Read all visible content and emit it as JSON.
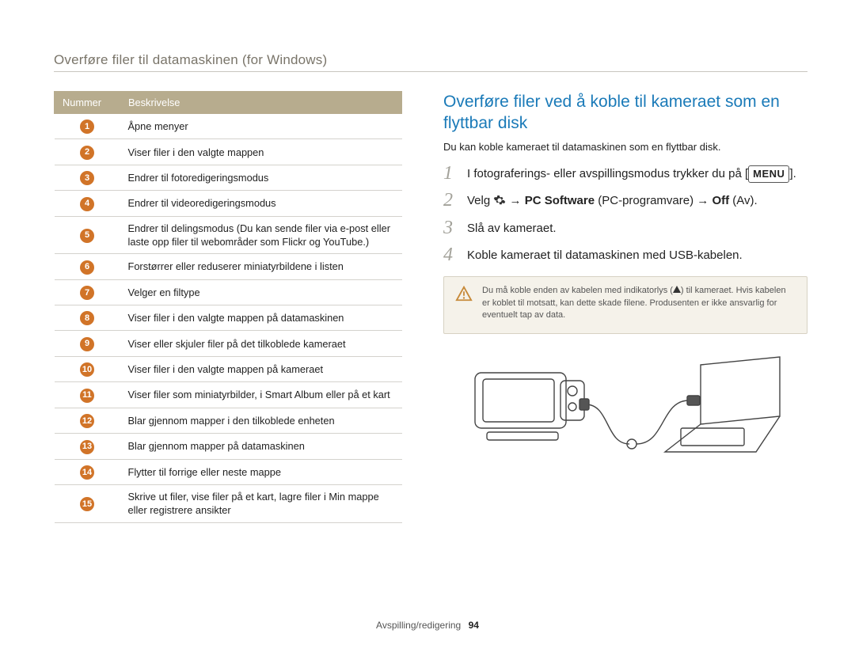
{
  "header": {
    "section_title": "Overføre filer til datamaskinen (for Windows)"
  },
  "table": {
    "columns": {
      "num": "Nummer",
      "desc": "Beskrivelse"
    },
    "rows": [
      {
        "n": "1",
        "desc": "Åpne menyer"
      },
      {
        "n": "2",
        "desc": "Viser filer i den valgte mappen"
      },
      {
        "n": "3",
        "desc": "Endrer til fotoredigeringsmodus"
      },
      {
        "n": "4",
        "desc": "Endrer til videoredigeringsmodus"
      },
      {
        "n": "5",
        "desc": "Endrer til delingsmodus (Du kan sende filer via e-post eller laste opp filer til webområder som Flickr og YouTube.)"
      },
      {
        "n": "6",
        "desc": "Forstørrer eller reduserer miniatyrbildene i listen"
      },
      {
        "n": "7",
        "desc": "Velger en filtype"
      },
      {
        "n": "8",
        "desc": "Viser filer i den valgte mappen på datamaskinen"
      },
      {
        "n": "9",
        "desc": "Viser eller skjuler filer på det tilkoblede kameraet"
      },
      {
        "n": "10",
        "desc": "Viser filer i den valgte mappen på kameraet"
      },
      {
        "n": "11",
        "desc": "Viser filer som miniatyrbilder, i Smart Album eller på et kart"
      },
      {
        "n": "12",
        "desc": "Blar gjennom mapper i den tilkoblede enheten"
      },
      {
        "n": "13",
        "desc": "Blar gjennom mapper på datamaskinen"
      },
      {
        "n": "14",
        "desc": "Flytter til forrige eller neste mappe"
      },
      {
        "n": "15",
        "desc": "Skrive ut filer, vise filer på et kart, lagre filer i Min mappe eller registrere ansikter"
      }
    ]
  },
  "right": {
    "heading": "Overføre filer ved å koble til kameraet som en flyttbar disk",
    "intro": "Du kan koble kameraet til datamaskinen som en flyttbar disk.",
    "steps": {
      "s1_a": "I fotograferings- eller avspillingsmodus trykker du på",
      "s1_menu": "MENU",
      "s1_b": ".",
      "s2_a": "Velg ",
      "s2_arrow1": " → ",
      "s2_bold1": "PC Software",
      "s2_paren1": " (PC-programvare) → ",
      "s2_bold2": "Off",
      "s2_paren2": " (Av).",
      "s3": "Slå av kameraet.",
      "s4": "Koble kameraet til datamaskinen med USB-kabelen."
    },
    "warn": {
      "a": "Du må koble enden av kabelen med indikatorlys (",
      "b": ") til kameraet. Hvis kabelen er koblet til motsatt, kan dette skade filene. Produsenten er ikke ansvarlig for eventuelt tap av data."
    }
  },
  "footer": {
    "label": "Avspilling/redigering",
    "page": "94"
  }
}
